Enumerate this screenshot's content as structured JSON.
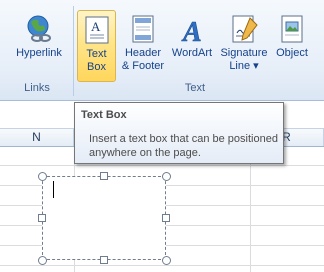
{
  "ribbon": {
    "links_group": {
      "label": "Links",
      "hyperlink": "Hyperlink"
    },
    "text_group": {
      "label": "Text",
      "text_box": {
        "line1": "Text",
        "line2": "Box"
      },
      "header_footer": {
        "line1": "Header",
        "line2": "& Footer"
      },
      "wordart": "WordArt",
      "signature_line": {
        "line1": "Signature",
        "line2": "Line ▾"
      },
      "object": "Object"
    }
  },
  "tooltip": {
    "title": "Text Box",
    "description": "Insert a text box that can be positioned anywhere on the page."
  },
  "sheet": {
    "column_headers": [
      "N",
      "R"
    ]
  },
  "colors": {
    "ribbon_selected": "#ffd65c",
    "ribbon_text": "#15428b",
    "grid_line": "#dadcdd"
  },
  "icons": [
    "globe-link-icon",
    "textbox-icon",
    "header-footer-icon",
    "wordart-icon",
    "signature-line-icon",
    "object-icon"
  ]
}
